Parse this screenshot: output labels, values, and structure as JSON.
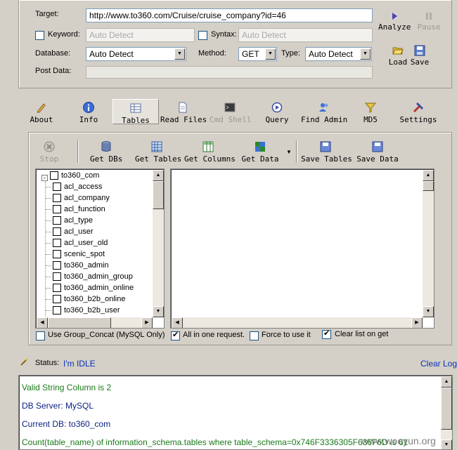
{
  "request": {
    "target_label": "Target:",
    "target_value": "http://www.to360.com/Cruise/cruise_company?id=46",
    "keyword_label": "Keyword:",
    "keyword_placeholder": "Auto Detect",
    "syntax_label": "Syntax:",
    "syntax_placeholder": "Auto Detect",
    "database_label": "Database:",
    "database_value": "Auto Detect",
    "method_label": "Method:",
    "method_value": "GET",
    "type_label": "Type:",
    "type_value": "Auto Detect",
    "postdata_label": "Post Data:",
    "postdata_value": ""
  },
  "actions": {
    "analyze": "Analyze",
    "pause": "Pause",
    "load": "Load",
    "save": "Save"
  },
  "main_toolbar": {
    "about": "About",
    "info": "Info",
    "tables": "Tables",
    "read_files": "Read Files",
    "cmd_shell": "Cmd Shell",
    "query": "Query",
    "find_admin": "Find Admin",
    "md5": "MD5",
    "settings": "Settings"
  },
  "tables_toolbar": {
    "stop": "Stop",
    "get_dbs": "Get DBs",
    "get_tables": "Get Tables",
    "get_columns": "Get Columns",
    "get_data": "Get Data",
    "save_tables": "Save Tables",
    "save_data": "Save Data"
  },
  "tree": {
    "root": "to360_com",
    "tables": [
      "acl_access",
      "acl_company",
      "acl_function",
      "acl_type",
      "acl_user",
      "acl_user_old",
      "scenic_spot",
      "to360_admin",
      "to360_admin_group",
      "to360_admin_online",
      "to360_b2b_online",
      "to360_b2b_user"
    ]
  },
  "options": {
    "group_concat": "Use Group_Concat (MySQL Only)",
    "all_in_one": "All in one request.",
    "force": "Force to use it",
    "clear_list": "Clear list on get"
  },
  "status": {
    "label": "Status:",
    "value": "I'm IDLE",
    "clear_log": "Clear Log"
  },
  "log": [
    {
      "text": "Valid String Column is 2",
      "color": "#1a7a1a"
    },
    {
      "text": "DB Server: MySQL",
      "color": "#0a1f80"
    },
    {
      "text": "Current DB: to360_com",
      "color": "#0a1f80"
    },
    {
      "text": "Count(table_name) of information_schema.tables where table_schema=0x746F3336305F636F6D is 61",
      "color": "#1a7a1a"
    }
  ],
  "watermark": "www.wooyun.org",
  "colors": {
    "background": "#d4d0c8",
    "link": "#0a2fb5",
    "log_green": "#1a7a1a",
    "log_blue": "#0a1f80"
  }
}
